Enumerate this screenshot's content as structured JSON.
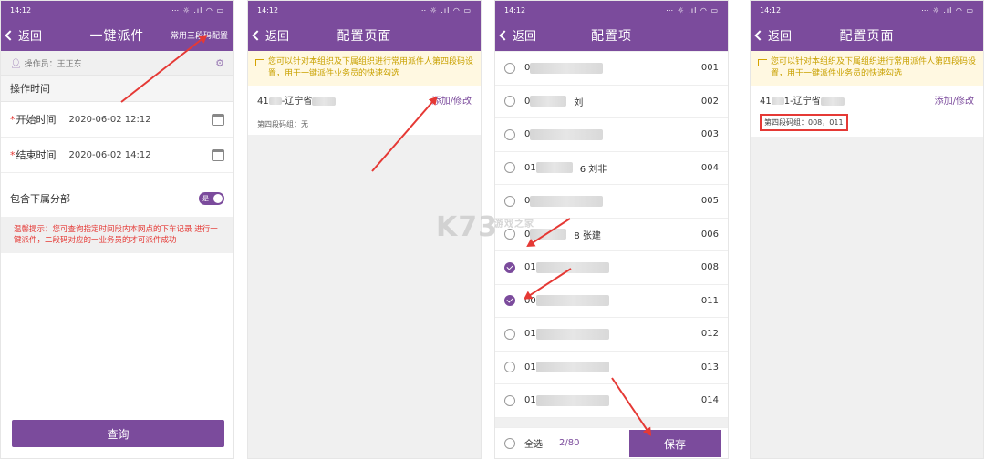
{
  "status_time": "14:12",
  "status_icons": "⋯ ☼ .ıl ◠ ▭",
  "screen1": {
    "back": "返回",
    "title": "一键派件",
    "right_link": "常用三段码配置",
    "operator": "操作员：王正东",
    "section_title": "操作时间",
    "start_label": "开始时间",
    "start_value": "2020-06-02 12:12",
    "end_label": "结束时间",
    "end_value": "2020-06-02 14:12",
    "toggle_label": "包含下属分部",
    "toggle_state": "是",
    "tip": "温馨提示：您可查询指定时间段内本网点的下车记录 进行一键派件，二段码对应的一业务员的才可派件成功",
    "query_button": "查询"
  },
  "screen2": {
    "back": "返回",
    "title": "配置页面",
    "notice": "您可以针对本组织及下属组织进行常用派件人第四段码设置，用于一键派件业务员的快速勾选",
    "org_prefix": "41",
    "org_name": "-辽宁省",
    "action": "添加/修改",
    "sub": "第四段码组：无"
  },
  "screen3": {
    "back": "返回",
    "title": "配置项",
    "items": [
      {
        "prefix": "0",
        "name": "",
        "code": "001",
        "checked": false
      },
      {
        "prefix": "0",
        "name": "刘",
        "code": "002",
        "checked": false
      },
      {
        "prefix": "0",
        "name": "",
        "code": "003",
        "checked": false
      },
      {
        "prefix": "01",
        "name": "6 刘非",
        "code": "004",
        "checked": false
      },
      {
        "prefix": "0",
        "name": "",
        "code": "005",
        "checked": false
      },
      {
        "prefix": "0",
        "name": "8 张建",
        "code": "006",
        "checked": false
      },
      {
        "prefix": "01",
        "name": "",
        "code": "008",
        "checked": true
      },
      {
        "prefix": "00",
        "name": "",
        "code": "011",
        "checked": true
      },
      {
        "prefix": "01",
        "name": "",
        "code": "012",
        "checked": false
      },
      {
        "prefix": "01",
        "name": "",
        "code": "013",
        "checked": false
      },
      {
        "prefix": "01",
        "name": "",
        "code": "014",
        "checked": false
      }
    ],
    "select_all": "全选",
    "count": "2/80",
    "save": "保存"
  },
  "screen4": {
    "back": "返回",
    "title": "配置页面",
    "notice": "您可以针对本组织及下属组织进行常用派件人第四段码设置，用于一键派件业务员的快速勾选",
    "org_prefix": "41",
    "org_name": "1-辽宁省",
    "action": "添加/修改",
    "sub": "第四段码组：008，011"
  },
  "watermark": "K73",
  "watermark_sub": "游戏之家",
  "accent_color": "#7b4b9c",
  "arrow_color": "#e53935"
}
